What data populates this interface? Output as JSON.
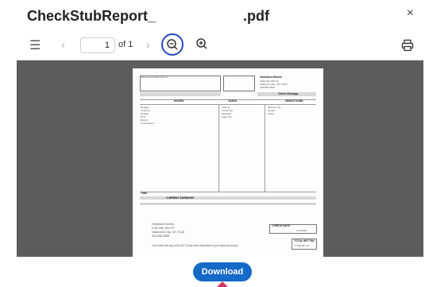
{
  "header": {
    "title_part1": "CheckStubReport_",
    "title_part2": ".pdf",
    "close_symbol": "×"
  },
  "toolbar": {
    "menu_icon": "☰",
    "prev_icon": "‹",
    "next_icon": "›",
    "page_value": "1",
    "page_total_label": "of 1"
  },
  "document": {
    "employer_name": "Heartland Homes",
    "employer_address": "2132 NW 10th ST",
    "employer_city": "Oklahoma City, OK 73116",
    "employer_phone": "405-555-5555",
    "stub_title": "Statement of Earnings For",
    "check_message": "Check Message",
    "taxes_label": "TAXES",
    "deductions_label": "DEDUCTIONS",
    "current_earnings_label": "CURRENT EARNINGS",
    "hours_label": "HOURS",
    "total_label": "Total",
    "check_date_label": "CHECK DATE",
    "check_date_value": "1/15/2023",
    "total_net_pay_label": "TOTAL NET PAY",
    "total_net_pay_value": "*****$1,057.10",
    "deposit_note": "Your entire Net pay of $1,057.10 has been deposited in your bank account(s).",
    "earning_rows": [
      "Regular",
      "Overtime",
      "Holiday",
      "PTO",
      "Bonus",
      "Commission"
    ],
    "tax_rows": [
      "Federal",
      "Social Sec",
      "Medicare",
      "State Tax"
    ],
    "deduction_rows": [
      "Med Pre Tax",
      "Dental",
      "Vision"
    ]
  },
  "footer": {
    "download_label": "Download"
  },
  "colors": {
    "accent": "#1569c7",
    "zoom_ring": "#2b47c9",
    "viewer_bg": "#5c5c5c",
    "cursor": "#d03a5c"
  }
}
